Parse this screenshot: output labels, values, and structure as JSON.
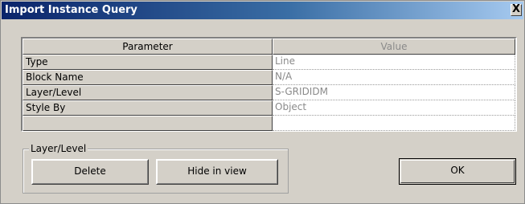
{
  "window": {
    "title": "Import Instance Query",
    "close_glyph": "X"
  },
  "table": {
    "headers": {
      "parameter": "Parameter",
      "value": "Value"
    },
    "rows": [
      {
        "parameter": "Type",
        "value": "Line"
      },
      {
        "parameter": "Block Name",
        "value": "N/A"
      },
      {
        "parameter": "Layer/Level",
        "value": "S-GRIDIDM"
      },
      {
        "parameter": "Style By",
        "value": "Object"
      },
      {
        "parameter": "",
        "value": ""
      }
    ]
  },
  "layer_group": {
    "label": "Layer/Level",
    "delete_label": "Delete",
    "hide_label": "Hide in view"
  },
  "buttons": {
    "ok_label": "OK"
  }
}
